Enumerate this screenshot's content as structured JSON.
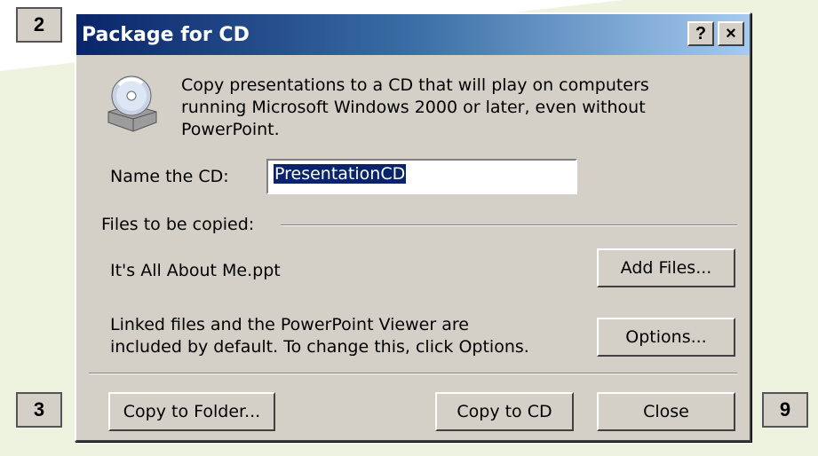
{
  "steps": {
    "left_top": "2",
    "left_bottom": "3",
    "right_bottom": "9"
  },
  "dialog": {
    "title": "Package for CD",
    "help_button": "?",
    "close_button": "×",
    "description": "Copy presentations to a CD that will play on computers running Microsoft Windows 2000 or later, even without PowerPoint.",
    "description_lines": [
      "Copy presentations to a CD that will play on computers",
      "running Microsoft Windows 2000 or later, even without",
      "PowerPoint."
    ],
    "name_label": "Name the CD:",
    "name_value": "PresentationCD",
    "files_label": "Files to be copied:",
    "file_name": "It's All About Me.ppt",
    "linked_note_lines": [
      "Linked files and the PowerPoint Viewer are",
      "included by default. To change this, click Options."
    ],
    "buttons": {
      "add_files": "Add Files...",
      "options": "Options...",
      "copy_to_folder": "Copy to Folder...",
      "copy_to_cd": "Copy to CD",
      "close": "Close"
    }
  },
  "colors": {
    "dialog_face": "#d4d0c8",
    "title_gradient_start": "#0a246a",
    "title_gradient_end": "#a6caf0",
    "background_accent": "#eef3df"
  }
}
